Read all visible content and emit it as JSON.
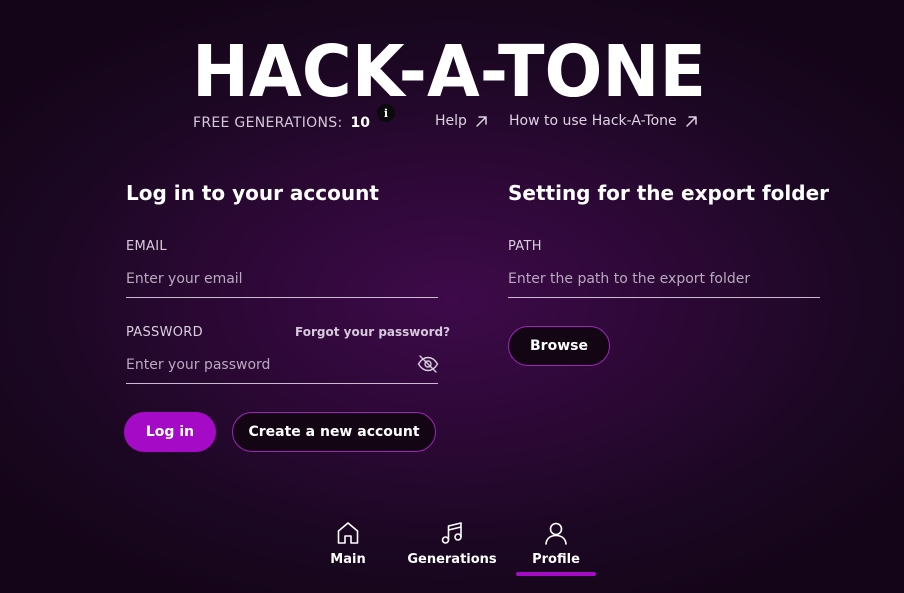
{
  "header": {
    "logo_text": "HACK-A-TONE",
    "free_generations_label": "FREE GENERATIONS:",
    "free_generations_count": "10",
    "info_icon": "info-icon",
    "links": {
      "help": "Help",
      "how_to": "How to use Hack-A-Tone"
    }
  },
  "login": {
    "title": "Log in to your account",
    "email_label": "EMAIL",
    "email_placeholder": "Enter your email",
    "email_value": "",
    "password_label": "PASSWORD",
    "forgot_label": "Forgot your password?",
    "password_placeholder": "Enter your password",
    "password_value": "",
    "login_button": "Log in",
    "create_button": "Create a new account"
  },
  "export": {
    "title": "Setting for the export folder",
    "path_label": "PATH",
    "path_placeholder": "Enter the path to the export folder",
    "path_value": "",
    "browse_button": "Browse"
  },
  "nav": {
    "items": [
      {
        "label": "Main",
        "icon": "home-icon"
      },
      {
        "label": "Generations",
        "icon": "music-note-icon"
      },
      {
        "label": "Profile",
        "icon": "user-icon",
        "active": true
      }
    ]
  },
  "colors": {
    "accent": "#a50bc6",
    "background": "#1b0722",
    "text": "#ffffff"
  }
}
